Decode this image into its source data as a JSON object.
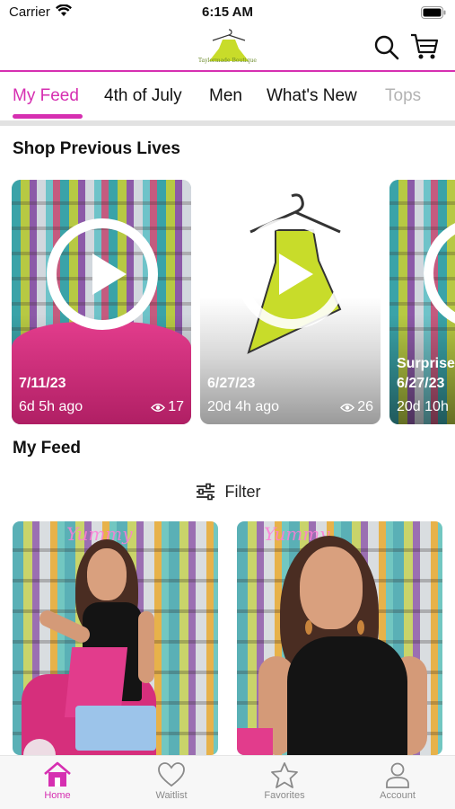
{
  "status_bar": {
    "carrier": "Carrier",
    "time": "6:15 AM"
  },
  "header": {
    "logo_text": "Taylormade Boutique"
  },
  "tabs": [
    "My Feed",
    "4th of July",
    "Men",
    "What's New",
    "Tops"
  ],
  "sections": {
    "previous_lives": "Shop Previous Lives",
    "my_feed": "My Feed"
  },
  "lives": [
    {
      "date": "7/11/23",
      "ago": "6d 5h ago",
      "views": "17"
    },
    {
      "date": "6/27/23",
      "ago": "20d 4h ago",
      "views": "26"
    },
    {
      "title": "Surprise",
      "date": "6/27/23",
      "ago": "20d 10h"
    }
  ],
  "filter": {
    "label": "Filter"
  },
  "feed_neon": [
    "Yummy",
    "Yummy"
  ],
  "bottom_nav": [
    {
      "label": "Home",
      "icon": "home-icon",
      "active": true
    },
    {
      "label": "Waitlist",
      "icon": "heart-icon"
    },
    {
      "label": "Favorites",
      "icon": "star-icon"
    },
    {
      "label": "Account",
      "icon": "person-icon"
    }
  ],
  "colors": {
    "accent": "#d62fb1",
    "logo_green": "#c8dc2a"
  }
}
